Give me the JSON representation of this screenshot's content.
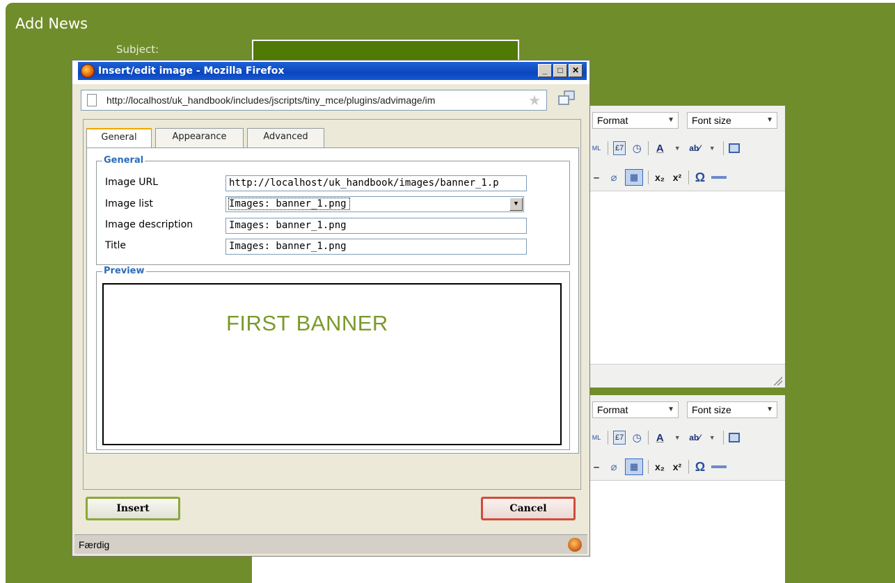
{
  "page": {
    "title": "Add News",
    "subject_label": "Subject:"
  },
  "editor": {
    "format_label": "Format",
    "fontsize_label": "Font size",
    "toolbar_row1_icons": [
      "html-icon",
      "insert-date-icon",
      "insert-time-icon",
      "forecolor-icon",
      "backcolor-icon",
      "fullscreen-icon"
    ],
    "toolbar_row2_icons": [
      "cleanup-icon",
      "table-icon",
      "subscript-icon",
      "superscript-icon",
      "charmap-icon",
      "hr-icon"
    ]
  },
  "popup": {
    "window_title": "Insert/edit image - Mozilla Firefox",
    "url": "http://localhost/uk_handbook/includes/jscripts/tiny_mce/plugins/advimage/im",
    "tabs": [
      {
        "label": "General",
        "active": true
      },
      {
        "label": "Appearance",
        "active": false
      },
      {
        "label": "Advanced",
        "active": false
      }
    ],
    "general_legend": "General",
    "fields": {
      "image_url_label": "Image URL",
      "image_url_value": "http://localhost/uk_handbook/images/banner_1.p",
      "image_list_label": "Image list",
      "image_list_value": "Images: banner_1.png",
      "image_description_label": "Image description",
      "image_description_value": "Images: banner_1.png",
      "title_label": "Title",
      "title_value": "Images: banner_1.png"
    },
    "preview_legend": "Preview",
    "preview_banner_text": "FIRST BANNER",
    "insert_label": "Insert",
    "cancel_label": "Cancel",
    "status_text": "Færdig"
  },
  "colors": {
    "page_green": "#6f8d2b",
    "titlebar_blue": "#0a46c0",
    "legend_blue": "#2b6cb8",
    "banner_green": "#7a9a2a"
  }
}
